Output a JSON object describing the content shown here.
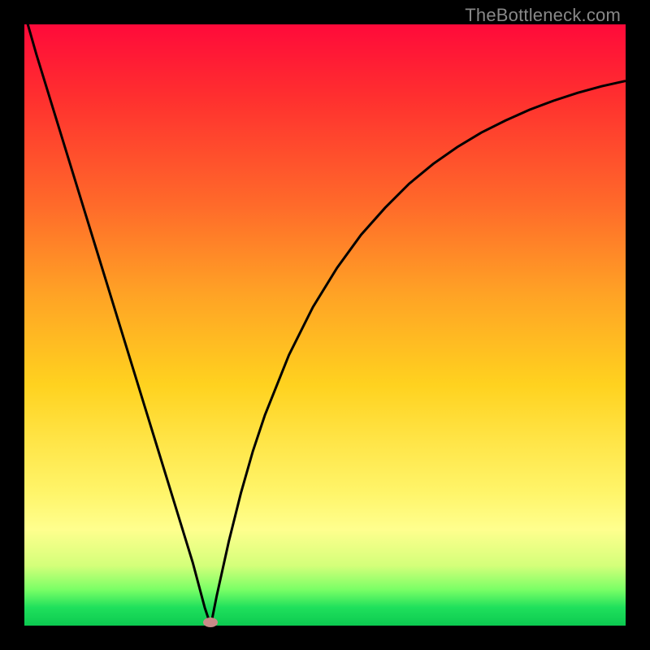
{
  "watermark": {
    "text": "TheBottleneck.com"
  },
  "colors": {
    "background": "#000000",
    "curve": "#000000",
    "marker": "#c98a88"
  },
  "chart_data": {
    "type": "line",
    "title": "",
    "xlabel": "",
    "ylabel": "",
    "xlim": [
      0,
      100
    ],
    "ylim": [
      0,
      100
    ],
    "grid": false,
    "series": [
      {
        "name": "bottleneck-curve",
        "x": [
          0,
          2,
          4,
          6,
          8,
          10,
          12,
          14,
          16,
          18,
          20,
          22,
          24,
          26,
          28,
          30,
          31,
          32,
          34,
          36,
          38,
          40,
          44,
          48,
          52,
          56,
          60,
          64,
          68,
          72,
          76,
          80,
          84,
          88,
          92,
          96,
          100
        ],
        "y": [
          102,
          95,
          88.5,
          82,
          75.5,
          69,
          62.5,
          56,
          49.5,
          43,
          36.5,
          30,
          23.5,
          17,
          10.5,
          3,
          0,
          5,
          14,
          22,
          29,
          35,
          45,
          53,
          59.5,
          65,
          69.5,
          73.5,
          76.8,
          79.6,
          82,
          84,
          85.8,
          87.3,
          88.6,
          89.7,
          90.6
        ]
      }
    ],
    "marker": {
      "x": 31,
      "y": 0.5
    }
  }
}
